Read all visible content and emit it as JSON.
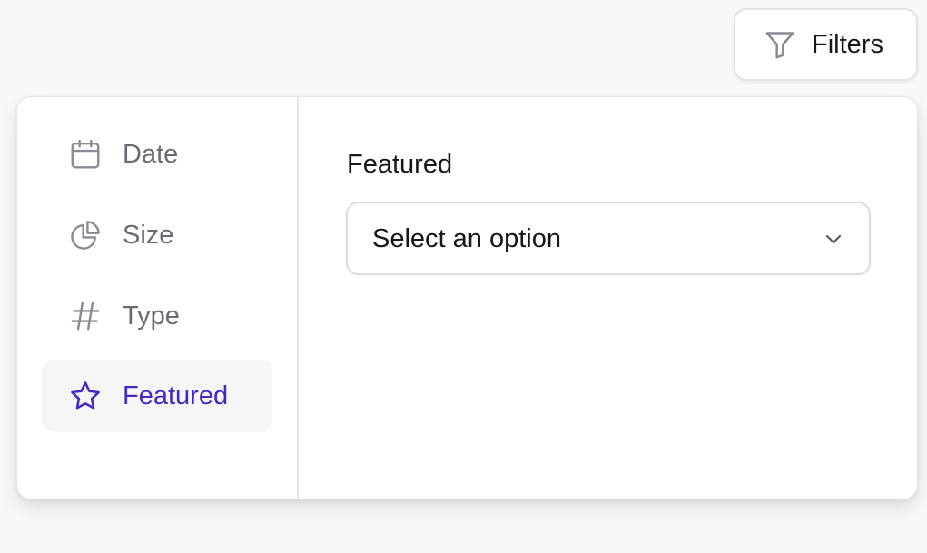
{
  "toolbar": {
    "filters_label": "Filters",
    "filters_icon": "filter-funnel-icon"
  },
  "sidebar": {
    "items": [
      {
        "label": "Date",
        "icon": "calendar-icon",
        "active": false
      },
      {
        "label": "Size",
        "icon": "pie-chart-icon",
        "active": false
      },
      {
        "label": "Type",
        "icon": "hash-icon",
        "active": false
      },
      {
        "label": "Featured",
        "icon": "star-icon",
        "active": true
      }
    ]
  },
  "content": {
    "title": "Featured",
    "select": {
      "value": "Select an option",
      "icon": "chevron-down-icon"
    }
  },
  "colors": {
    "accent": "#4526c8",
    "muted_text": "#6b6b76",
    "text": "#17171c",
    "active_bg": "#f6f6f7",
    "border": "#e6e6e9"
  }
}
